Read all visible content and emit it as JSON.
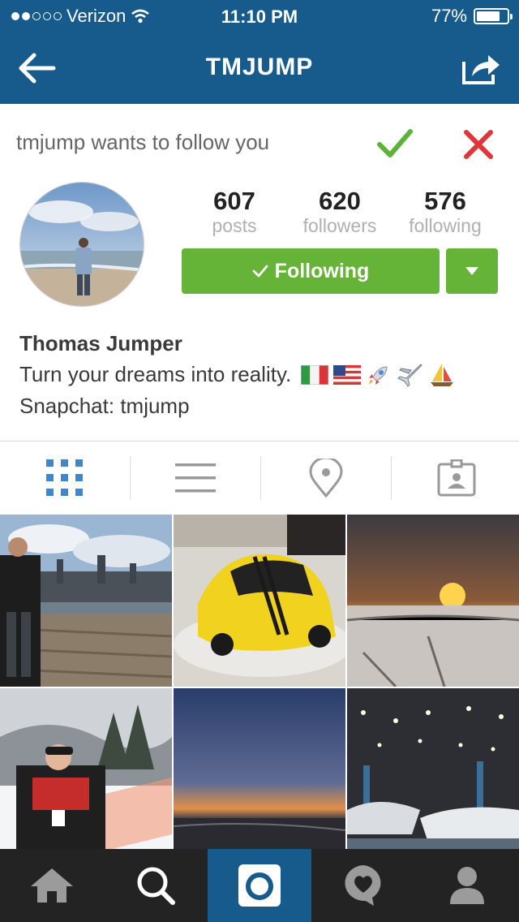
{
  "status_bar": {
    "carrier": "Verizon",
    "time": "11:10 PM",
    "battery": "77%",
    "battery_level": 0.77
  },
  "nav": {
    "title": "TMJUMP"
  },
  "follow_request": {
    "text": "tmjump wants to follow you"
  },
  "stats": [
    {
      "value": "607",
      "label": "posts"
    },
    {
      "value": "620",
      "label": "followers"
    },
    {
      "value": "576",
      "label": "following"
    }
  ],
  "follow_button": {
    "label": "Following"
  },
  "profile": {
    "name": "Thomas Jumper",
    "bio_line1": "Turn your dreams into reality.",
    "bio_line2": "Snapchat: tmjump"
  },
  "colors": {
    "brand": "#175a8c",
    "follow_green": "#65b337",
    "accept_green": "#5cb338",
    "decline_red": "#e0363a",
    "tab_active_blue": "#3f87c9"
  },
  "icons": {
    "nav": [
      "back-arrow-icon",
      "share-icon"
    ],
    "profile_tabs": [
      "grid-icon",
      "list-icon",
      "location-pin-icon",
      "tagged-photos-icon"
    ],
    "tab_bar": [
      "home-icon",
      "search-icon",
      "camera-icon",
      "activity-heart-icon",
      "profile-icon"
    ],
    "emojis": [
      "italy-flag-emoji",
      "us-flag-emoji",
      "rocket-emoji",
      "airplane-emoji",
      "sailboat-emoji"
    ]
  }
}
